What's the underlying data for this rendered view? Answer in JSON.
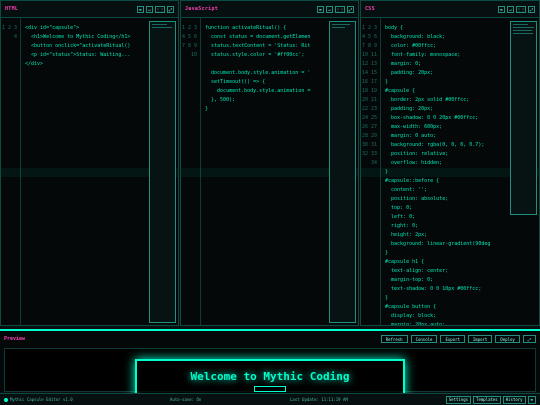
{
  "panes": {
    "html": {
      "title": "HTML",
      "gutter": "1\n2\n3\n4",
      "code": "<div id=\"capsule\">\n  <h1>Welcome to Mythic Coding</h1>\n  <button onclick=\"activateRitual()\n  <p id=\"status\">Status: Waiting...\n</div>"
    },
    "js": {
      "title": "JavaScript",
      "gutter": "1\n2\n3\n4\n5\n6\n7\n8\n9\n10",
      "code": "function activateRitual() {\n  const status = document.getElemen\n  status.textContent = 'Status: Rit\n  status.style.color = '#ff00cc';\n\n  document.body.style.animation = '\n  setTimeout(() => {\n    document.body.style.animation =\n  }, 500);\n}"
    },
    "css": {
      "title": "CSS",
      "gutter": "1\n2\n3\n4\n5\n6\n7\n8\n9\n10\n11\n12\n13\n14\n15\n16\n17\n18\n19\n20\n21\n22\n23\n24\n25\n26\n27\n28\n29\n30\n31\n32\n33\n34",
      "code": "body {\n  background: black;\n  color: #00ffcc;\n  font-family: monospace;\n  margin: 0;\n  padding: 20px;\n}\n#capsule {\n  border: 2px solid #00ffcc;\n  padding: 20px;\n  box-shadow: 0 0 20px #00ffcc;\n  max-width: 600px;\n  margin: 0 auto;\n  background: rgba(0, 0, 0, 0.7);\n  position: relative;\n  overflow: hidden;\n}\n#capsule::before {\n  content: '';\n  position: absolute;\n  top: 0;\n  left: 0;\n  right: 0;\n  height: 2px;\n  background: linear-gradient(90deg\n}\n#capsule h1 {\n  text-align: center;\n  margin-top: 0;\n  text-shadow: 0 0 10px #00ffcc;\n}\n#capsule button {\n  display: block;\n  margin: 20px auto;"
    }
  },
  "preview": {
    "title": "Preview",
    "buttons": [
      "Refresh",
      "Console",
      "Export",
      "Import",
      "Deploy"
    ],
    "heading": "Welcome to Mythic Coding"
  },
  "status": {
    "app": "Mythic Capsule Editor v1.0",
    "autosave": "Auto-save: On",
    "updated": "Last Update: 11:11:19 AM",
    "buttons": [
      "Settings",
      "Templates",
      "History"
    ]
  },
  "colors": {
    "accent": "#00ffcc",
    "title": "#ff3fb4"
  }
}
